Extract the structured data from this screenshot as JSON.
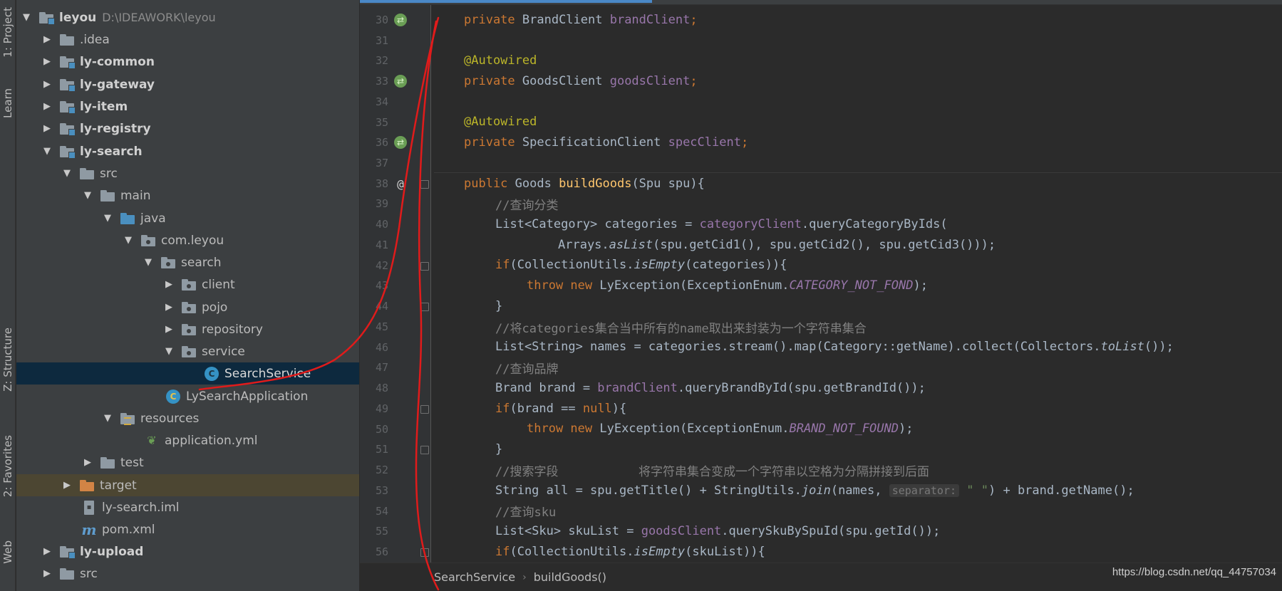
{
  "tool_windows": {
    "project_tab": "1: Project",
    "learn_tab": "Learn",
    "structure_tab": "Z: Structure",
    "favorites_tab": "2: Favorites",
    "web_tab": "Web"
  },
  "project_tree": {
    "root_name": "leyou",
    "root_path": "D:\\IDEAWORK\\leyou",
    "items": [
      {
        "label": ".idea"
      },
      {
        "label": "ly-common"
      },
      {
        "label": "ly-gateway"
      },
      {
        "label": "ly-item"
      },
      {
        "label": "ly-registry"
      },
      {
        "label": "ly-search"
      },
      {
        "label": "src"
      },
      {
        "label": "main"
      },
      {
        "label": "java"
      },
      {
        "label": "com.leyou"
      },
      {
        "label": "search"
      },
      {
        "label": "client"
      },
      {
        "label": "pojo"
      },
      {
        "label": "repository"
      },
      {
        "label": "service"
      },
      {
        "label": "SearchService"
      },
      {
        "label": "LySearchApplication"
      },
      {
        "label": "resources"
      },
      {
        "label": "application.yml"
      },
      {
        "label": "test"
      },
      {
        "label": "target"
      },
      {
        "label": "ly-search.iml"
      },
      {
        "label": "pom.xml"
      },
      {
        "label": "ly-upload"
      },
      {
        "label": "src"
      }
    ]
  },
  "editor": {
    "line_numbers": [
      "30",
      "31",
      "32",
      "33",
      "34",
      "35",
      "36",
      "37",
      "38",
      "39",
      "40",
      "41",
      "42",
      "43",
      "44",
      "45",
      "46",
      "47",
      "48",
      "49",
      "50",
      "51",
      "52",
      "53",
      "54",
      "55",
      "56"
    ],
    "code": {
      "l30": {
        "kw": "private ",
        "type": "BrandClient ",
        "field": "brandClient",
        "end": ";"
      },
      "l32": {
        "ann": "@Autowired"
      },
      "l33": {
        "kw": "private ",
        "type": "GoodsClient ",
        "field": "goodsClient",
        "end": ";"
      },
      "l35": {
        "ann": "@Autowired"
      },
      "l36": {
        "kw": "private ",
        "type": "SpecificationClient ",
        "field": "specClient",
        "end": ";"
      },
      "l38": {
        "kw": "public ",
        "type": "Goods ",
        "fn": "buildGoods",
        "rest": "(Spu spu){"
      },
      "l39": {
        "comment": "//查询分类"
      },
      "l40": {
        "a": "List<Category> categories = ",
        "field": "categoryClient",
        "b": ".queryCategoryByIds("
      },
      "l41": {
        "a": "Arrays.",
        "ital": "asList",
        "b": "(spu.getCid1(), spu.getCid2(), spu.getCid3()));"
      },
      "l42": {
        "kw": "if",
        "a": "(CollectionUtils.",
        "ital": "isEmpty",
        "b": "(categories)){"
      },
      "l43": {
        "kw": "throw new ",
        "a": "LyException(ExceptionEnum.",
        "const": "CATEGORY_NOT_FOND",
        "b": ");"
      },
      "l44": {
        "a": "}"
      },
      "l45": {
        "comment": "//将categories集合当中所有的name取出来封装为一个字符串集合"
      },
      "l46": {
        "a": "List<String> names = categories.stream().map(Category::getName).collect(Collectors.",
        "ital": "toList",
        "b": "());"
      },
      "l47": {
        "comment": "//查询品牌"
      },
      "l48": {
        "a": "Brand brand = ",
        "field": "brandClient",
        "b": ".queryBrandById(spu.getBrandId());"
      },
      "l49": {
        "kw": "if",
        "a": "(brand == ",
        "kw2": "null",
        "b": "){"
      },
      "l50": {
        "kw": "throw new ",
        "a": "LyException(ExceptionEnum.",
        "const": "BRAND_NOT_FOUND",
        "b": ");"
      },
      "l51": {
        "a": "}"
      },
      "l52": {
        "comment": "//搜索字段           将字符串集合变成一个字符串以空格为分隔拼接到后面"
      },
      "l53": {
        "a": "String all = spu.getTitle() + StringUtils.",
        "ital": "join",
        "b": "(names, ",
        "hint": "separator:",
        "str": "\" \"",
        "c": ") + brand.getName();"
      },
      "l54": {
        "comment": "//查询sku"
      },
      "l55": {
        "a": "List<Sku> skuList = ",
        "field": "goodsClient",
        "b": ".querySkuBySpuId(spu.getId());"
      },
      "l56": {
        "kw": "if",
        "a": "(CollectionUtils.",
        "ital": "isEmpty",
        "b": "(skuList)){"
      }
    }
  },
  "breadcrumb": {
    "class": "SearchService",
    "method": "buildGoods()"
  },
  "watermark": "https://blog.csdn.net/qq_44757034",
  "colors": {
    "keyword": "#cc7832",
    "annotation": "#bbb529",
    "field": "#9876aa",
    "method": "#ffc66d",
    "comment": "#808080",
    "string": "#6a8759",
    "scribble": "#e01b1b"
  }
}
